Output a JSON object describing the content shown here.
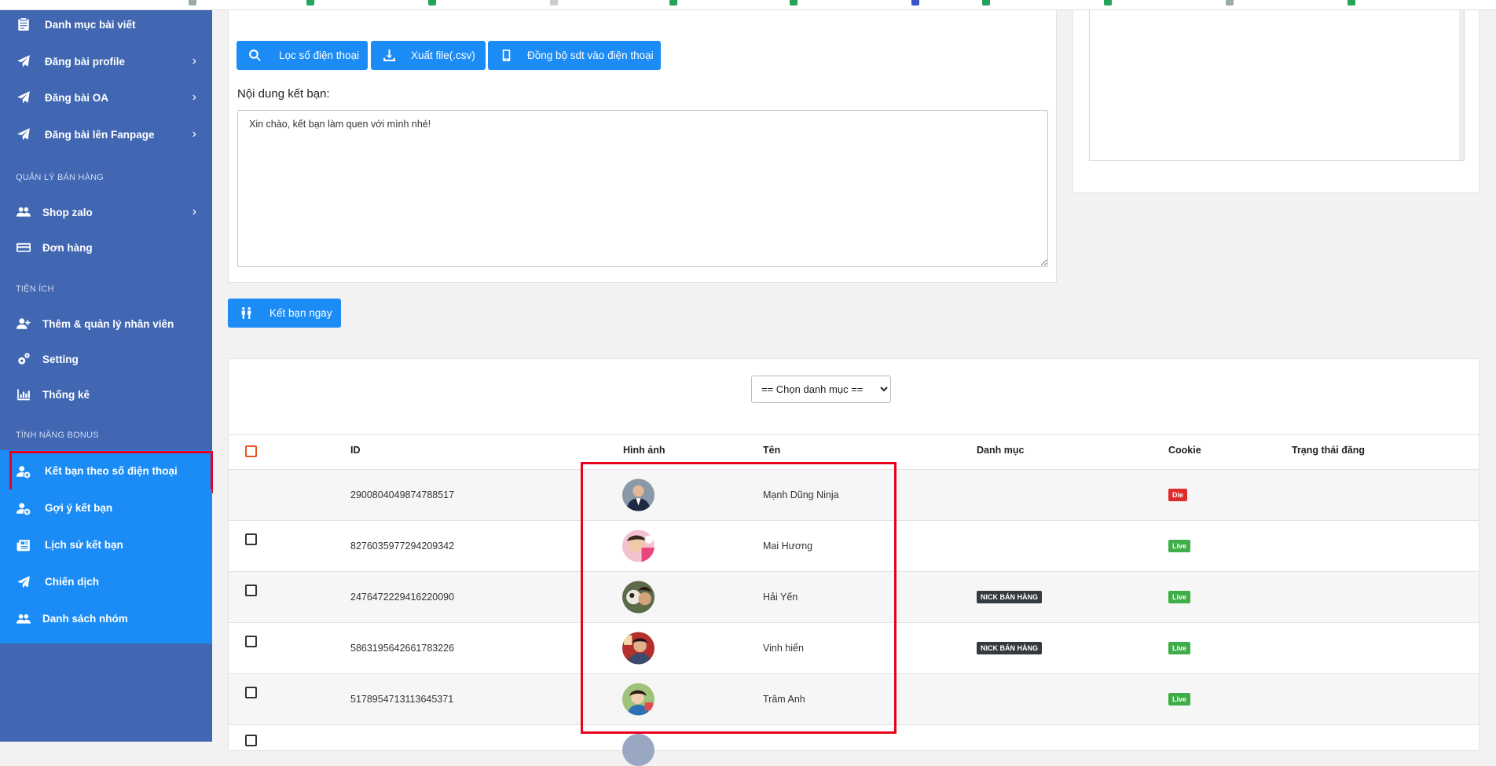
{
  "sidebar": {
    "items_top": [
      {
        "label": "Danh mục bài viết",
        "icon": "clipboard-icon",
        "chevron": ""
      },
      {
        "label": "Đăng bài profile",
        "icon": "paper-plane-icon",
        "chevron": "›"
      },
      {
        "label": "Đăng bài OA",
        "icon": "paper-plane-icon",
        "chevron": "›"
      },
      {
        "label": "Đăng bài lên Fanpage",
        "icon": "paper-plane-icon",
        "chevron": "›"
      }
    ],
    "sections": [
      {
        "heading": "QUẢN LÝ BÁN HÀNG"
      },
      {
        "heading": "TIỆN ÍCH"
      },
      {
        "heading": "TÍNH NĂNG BONUS"
      }
    ],
    "sales_items": [
      {
        "label": "Shop zalo",
        "icon": "users-icon",
        "chevron": "›"
      },
      {
        "label": "Đơn hàng",
        "icon": "credit-card-icon",
        "chevron": ""
      }
    ],
    "utility_items": [
      {
        "label": "Thêm & quản lý nhân viên",
        "icon": "user-plus-icon"
      },
      {
        "label": "Setting",
        "icon": "gears-icon"
      },
      {
        "label": "Thống kê",
        "icon": "bar-chart-icon"
      }
    ],
    "bonus_items": [
      {
        "label": "Kết bạn theo số điện thoại",
        "icon": "user-add-icon"
      },
      {
        "label": "Gợi ý kết bạn",
        "icon": "user-add-icon"
      },
      {
        "label": "Lịch sử kết bạn",
        "icon": "newspaper-icon"
      },
      {
        "label": "Chiến dịch",
        "icon": "paper-plane-icon"
      },
      {
        "label": "Danh sách nhóm",
        "icon": "users-icon"
      }
    ]
  },
  "toolbar": {
    "filter_label": "Lọc số điện thoại",
    "export_label": "Xuất file(.csv)",
    "sync_label": "Đồng bộ sdt vào điện thoại"
  },
  "friend_message": {
    "label": "Nội dung kết bạn:",
    "value": "Xin chào, kết bạn làm quen với mình nhé!"
  },
  "add_friend_button": "Kết bạn ngay",
  "category_select": {
    "selected": "== Chọn danh mục =="
  },
  "table": {
    "headers": {
      "id": "ID",
      "image": "Hình ảnh",
      "name": "Tên",
      "category": "Danh mục",
      "cookie": "Cookie",
      "status": "Trạng thái đăng"
    },
    "rows": [
      {
        "id": "2900804049874788517",
        "name": "Mạnh Dũng Ninja",
        "category": "",
        "cookie": "Die",
        "checkbox": false
      },
      {
        "id": "8276035977294209342",
        "name": "Mai Hương",
        "category": "",
        "cookie": "Live",
        "checkbox": true
      },
      {
        "id": "2476472229416220090",
        "name": "Hải Yến",
        "category": "NICK BÁN HÀNG",
        "cookie": "Live",
        "checkbox": true
      },
      {
        "id": "5863195642661783226",
        "name": "Vinh hiển",
        "category": "NICK BÁN HÀNG",
        "cookie": "Live",
        "checkbox": true
      },
      {
        "id": "5178954713113645371",
        "name": "Trâm Anh",
        "category": "",
        "cookie": "Live",
        "checkbox": true
      }
    ]
  },
  "colors": {
    "sidebar_bg": "#4167b3",
    "accent": "#1b8cf5",
    "highlight": "#e8001c",
    "live": "#3fae49",
    "die": "#e02b2b"
  }
}
